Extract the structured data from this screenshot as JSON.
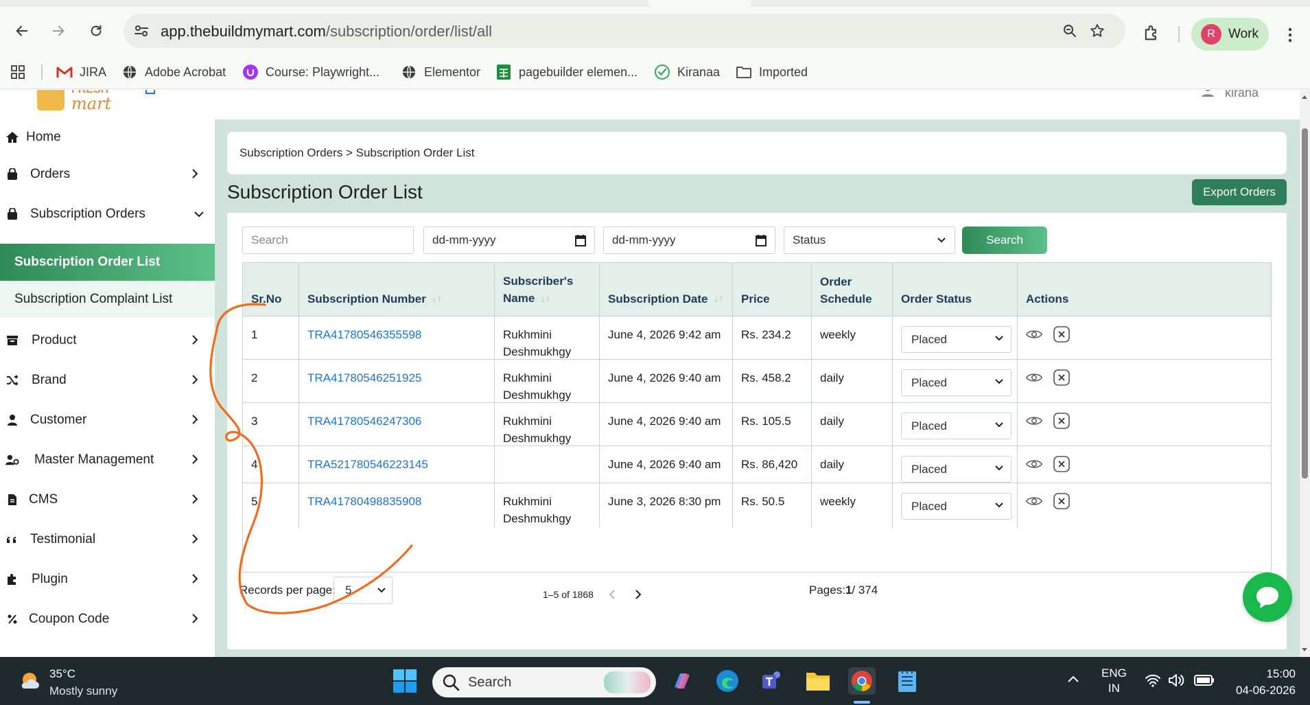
{
  "browser": {
    "url_host": "app.thebuildmymart.com",
    "url_path": "/subscription/order/list/all",
    "profile_initial": "R",
    "profile_label": "Work",
    "bookmarks": [
      "JIRA",
      "Adobe Acrobat",
      "Course: Playwright...",
      "Elementor",
      "pagebuilder elemen...",
      "Kiranaa",
      "Imported"
    ]
  },
  "header": {
    "user_label": "kirana"
  },
  "sidebar": {
    "items": [
      {
        "label": "Home",
        "icon": "home-icon"
      },
      {
        "label": "Orders",
        "icon": "bag-icon"
      },
      {
        "label": "Subscription Orders",
        "icon": "bag-icon"
      },
      {
        "label": "Product",
        "icon": "product-icon"
      },
      {
        "label": "Brand",
        "icon": "shuffle-icon"
      },
      {
        "label": "Customer",
        "icon": "user-icon"
      },
      {
        "label": "Master Management",
        "icon": "user-gear-icon"
      },
      {
        "label": "CMS",
        "icon": "file-icon"
      },
      {
        "label": "Testimonial",
        "icon": "quote-icon"
      },
      {
        "label": "Plugin",
        "icon": "puzzle-icon"
      },
      {
        "label": "Coupon Code",
        "icon": "percent-icon"
      }
    ],
    "sub_items": [
      {
        "label": "Subscription Order List",
        "active": true
      },
      {
        "label": "Subscription Complaint List",
        "active": false
      }
    ]
  },
  "main": {
    "breadcrumb": "Subscription Orders > Subscription Order List",
    "title": "Subscription Order List",
    "export_label": "Export Orders",
    "filters": {
      "search_placeholder": "Search",
      "date_from_placeholder": "dd-mm-yyyy",
      "date_to_placeholder": "dd-mm-yyyy",
      "status_placeholder": "Status",
      "search_button": "Search"
    },
    "table": {
      "headers": {
        "sr": "Sr.No",
        "number": "Subscription Number",
        "name_line1": "Subscriber's",
        "name_line2": "Name",
        "date": "Subscription Date",
        "price": "Price",
        "schedule_line1": "Order",
        "schedule_line2": "Schedule",
        "status": "Order Status",
        "actions": "Actions"
      },
      "rows": [
        {
          "sr": "1",
          "number": "TRA41780546355598",
          "name1": "Rukhmini",
          "name2": "Deshmukhgy",
          "date": "June 4, 2026 9:42 am",
          "price": "Rs. 234.2",
          "schedule": "weekly",
          "status": "Placed"
        },
        {
          "sr": "2",
          "number": "TRA41780546251925",
          "name1": "Rukhmini",
          "name2": "Deshmukhgy",
          "date": "June 4, 2026 9:40 am",
          "price": "Rs. 458.2",
          "schedule": "daily",
          "status": "Placed"
        },
        {
          "sr": "3",
          "number": "TRA41780546247306",
          "name1": "Rukhmini",
          "name2": "Deshmukhgy",
          "date": "June 4, 2026 9:40 am",
          "price": "Rs. 105.5",
          "schedule": "daily",
          "status": "Placed"
        },
        {
          "sr": "4",
          "number": "TRA521780546223145",
          "name1": "",
          "name2": "",
          "date": "June 4, 2026 9:40 am",
          "price": "Rs. 86,420",
          "schedule": "daily",
          "status": "Placed"
        },
        {
          "sr": "5",
          "number": "TRA41780498835908",
          "name1": "Rukhmini",
          "name2": "Deshmukhgy",
          "date": "June 3, 2026 8:30 pm",
          "price": "Rs. 50.5",
          "schedule": "weekly",
          "status": "Placed"
        }
      ]
    },
    "pagination": {
      "records_label": "Records per page:",
      "per_page": "5",
      "range": "1–5 of 1868",
      "pages_label": "Pages:",
      "current_page": "1",
      "total_pages": "/ 374"
    }
  },
  "taskbar": {
    "temperature": "35°C",
    "weather": "Mostly sunny",
    "search_label": "Search",
    "lang_line1": "ENG",
    "lang_line2": "IN",
    "time": "15:00",
    "date": "04-06-2026"
  },
  "colors": {
    "accent_green": "#2e7d5b",
    "link_blue": "#1976d2",
    "annotation_orange": "#f26a1b",
    "main_bg": "#cfe3da"
  }
}
